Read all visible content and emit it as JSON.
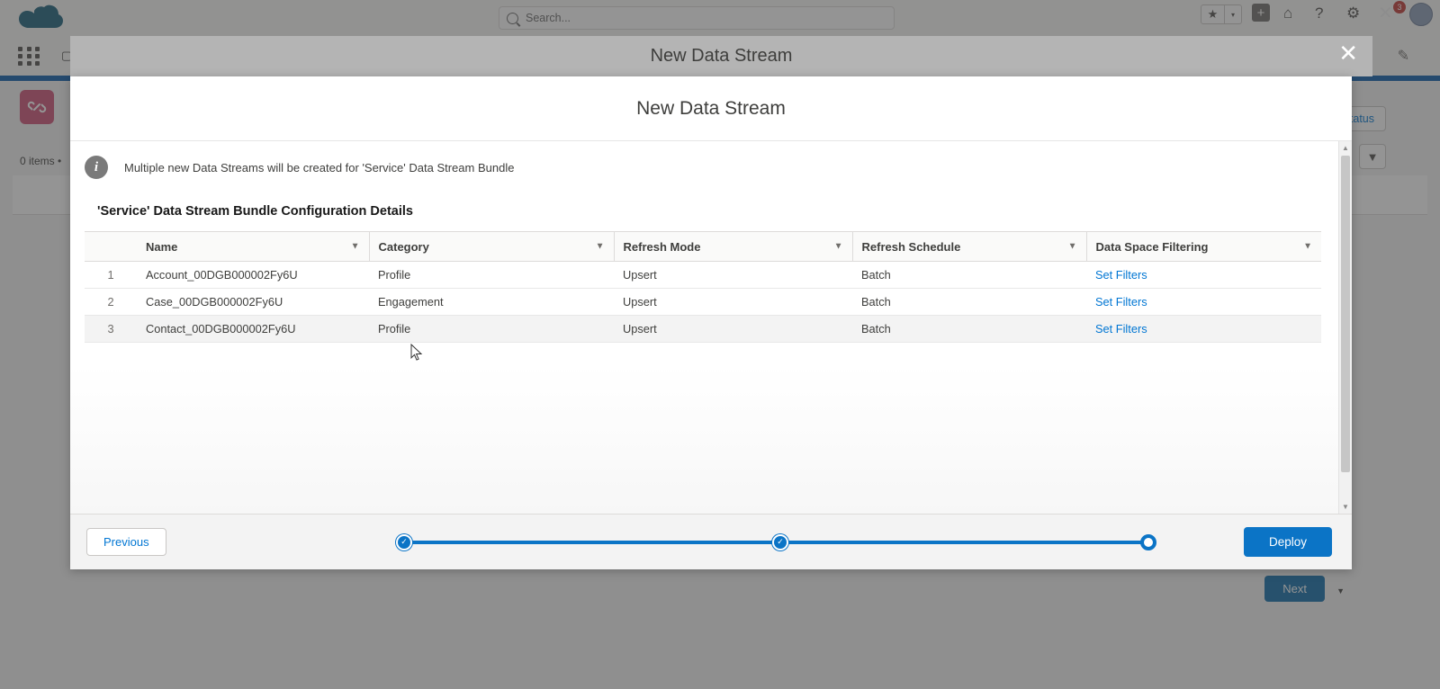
{
  "sf_header": {
    "logo": "salesforce-cloud-logo",
    "search_placeholder": "Search...",
    "icons": [
      {
        "name": "favorites-star-icon",
        "glyph": "★"
      },
      {
        "name": "favorites-dropdown-icon",
        "glyph": "▾"
      },
      {
        "name": "add-icon",
        "glyph": "+"
      },
      {
        "name": "home-cloud-icon",
        "glyph": "⌂"
      },
      {
        "name": "help-icon",
        "glyph": "?"
      },
      {
        "name": "setup-gear-icon",
        "glyph": "⚙"
      },
      {
        "name": "notifications-close-icon",
        "glyph": "✕"
      },
      {
        "name": "user-avatar",
        "glyph": ""
      }
    ],
    "notification_badge": "3"
  },
  "bg_page": {
    "object_icon": "data-stream-link-icon",
    "items_count": "0 items •",
    "status_button": "Status",
    "refresh_icon": "refresh-icon",
    "filter_icon": "filter-icon",
    "next_button": "Next",
    "edit_pencil_icon": "pencil-icon"
  },
  "overlay": {
    "title": "New Data Stream",
    "close_label": "✕"
  },
  "modal": {
    "title": "New Data Stream",
    "info_message": "Multiple new Data Streams will be created for 'Service' Data Stream Bundle",
    "info_icon": "info-icon",
    "section_title": "'Service' Data Stream Bundle Configuration Details",
    "table": {
      "columns": [
        {
          "label": "",
          "sortable": false
        },
        {
          "label": "Name",
          "sortable": true
        },
        {
          "label": "Category",
          "sortable": true
        },
        {
          "label": "Refresh Mode",
          "sortable": true
        },
        {
          "label": "Refresh Schedule",
          "sortable": true
        },
        {
          "label": "Data Space Filtering",
          "sortable": true
        }
      ],
      "rows": [
        {
          "index": "1",
          "name": "Account_00DGB000002Fy6U",
          "category": "Profile",
          "refresh_mode": "Upsert",
          "refresh_schedule": "Batch",
          "data_space_filtering": "Set Filters"
        },
        {
          "index": "2",
          "name": "Case_00DGB000002Fy6U",
          "category": "Engagement",
          "refresh_mode": "Upsert",
          "refresh_schedule": "Batch",
          "data_space_filtering": "Set Filters"
        },
        {
          "index": "3",
          "name": "Contact_00DGB000002Fy6U",
          "category": "Profile",
          "refresh_mode": "Upsert",
          "refresh_schedule": "Batch",
          "data_space_filtering": "Set Filters"
        }
      ]
    },
    "footer": {
      "previous_label": "Previous",
      "deploy_label": "Deploy",
      "progress_steps": [
        {
          "state": "complete",
          "glyph": "✓"
        },
        {
          "state": "complete",
          "glyph": "✓"
        },
        {
          "state": "current",
          "glyph": ""
        }
      ]
    },
    "scrollbar": {
      "up_glyph": "▲",
      "down_glyph": "▼"
    }
  },
  "colors": {
    "accent_blue": "#0b74c6",
    "link_blue": "#0176d3",
    "object_icon_bg": "#cf5175",
    "overlay_band": "#b4b4b4",
    "badge_red": "#c23934"
  }
}
